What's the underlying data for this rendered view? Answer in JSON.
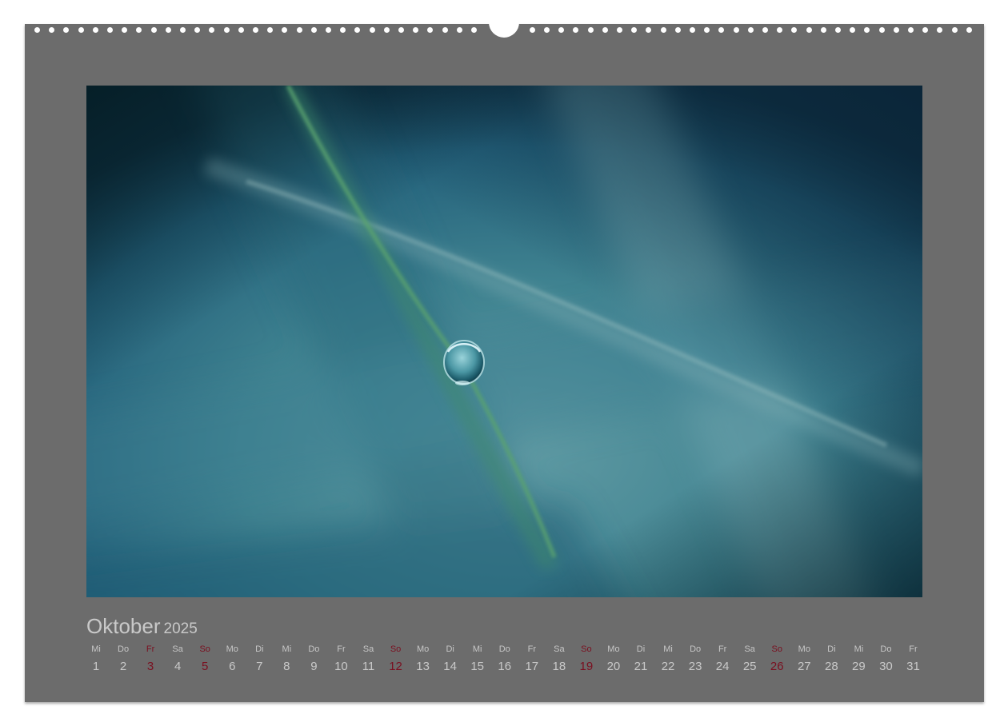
{
  "calendar": {
    "month": "Oktober",
    "year": "2025",
    "days": [
      {
        "dow": "Mi",
        "day": "1"
      },
      {
        "dow": "Do",
        "day": "2"
      },
      {
        "dow": "Fr",
        "day": "3",
        "holiday": true
      },
      {
        "dow": "Sa",
        "day": "4"
      },
      {
        "dow": "So",
        "day": "5",
        "holiday": true
      },
      {
        "dow": "Mo",
        "day": "6"
      },
      {
        "dow": "Di",
        "day": "7"
      },
      {
        "dow": "Mi",
        "day": "8"
      },
      {
        "dow": "Do",
        "day": "9"
      },
      {
        "dow": "Fr",
        "day": "10"
      },
      {
        "dow": "Sa",
        "day": "11"
      },
      {
        "dow": "So",
        "day": "12",
        "holiday": true
      },
      {
        "dow": "Mo",
        "day": "13"
      },
      {
        "dow": "Di",
        "day": "14"
      },
      {
        "dow": "Mi",
        "day": "15"
      },
      {
        "dow": "Do",
        "day": "16"
      },
      {
        "dow": "Fr",
        "day": "17"
      },
      {
        "dow": "Sa",
        "day": "18"
      },
      {
        "dow": "So",
        "day": "19",
        "holiday": true
      },
      {
        "dow": "Mo",
        "day": "20"
      },
      {
        "dow": "Di",
        "day": "21"
      },
      {
        "dow": "Mi",
        "day": "22"
      },
      {
        "dow": "Do",
        "day": "23"
      },
      {
        "dow": "Fr",
        "day": "24"
      },
      {
        "dow": "Sa",
        "day": "25"
      },
      {
        "dow": "So",
        "day": "26",
        "holiday": true
      },
      {
        "dow": "Mo",
        "day": "27"
      },
      {
        "dow": "Di",
        "day": "28"
      },
      {
        "dow": "Mi",
        "day": "29"
      },
      {
        "dow": "Do",
        "day": "30"
      },
      {
        "dow": "Fr",
        "day": "31"
      }
    ]
  },
  "colors": {
    "sheet": "#6c6c6c",
    "text": "#c9c9c9",
    "holiday": "#7a1020",
    "photo_teal": "#2d6f7d"
  }
}
